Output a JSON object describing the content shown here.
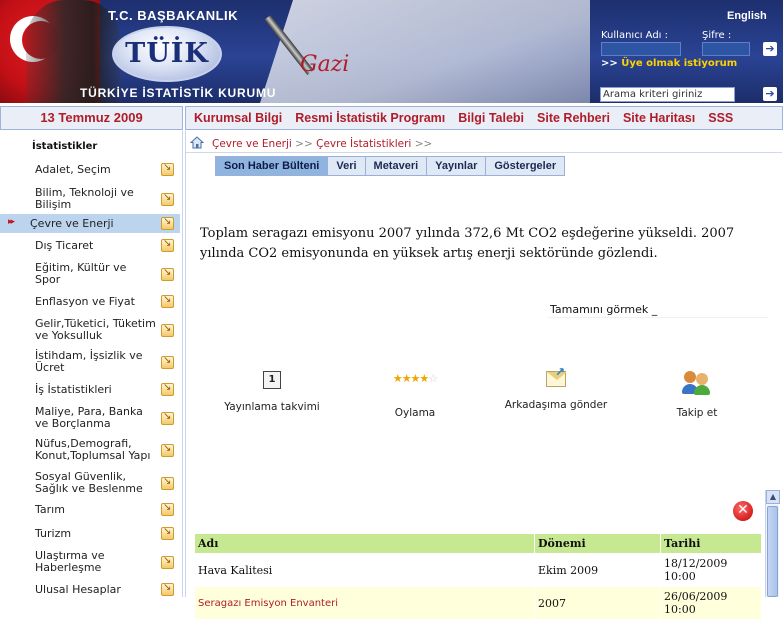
{
  "header": {
    "gov_title": "T.C. BAŞBAKANLIK",
    "logo_text": "TÜİK",
    "org_name": "TÜRKİYE İSTATİSTİK KURUMU",
    "language_link": "English",
    "login": {
      "username_label": "Kullanıcı Adı :",
      "password_label": "Şifre :",
      "go_label": "➔",
      "signup_arrows": ">>",
      "signup_text": "Üye olmak istiyorum"
    },
    "search": {
      "value": "Arama kriteri giriniz",
      "go_label": "➔"
    }
  },
  "date": "13 Temmuz 2009",
  "topnav": [
    {
      "label": "Kurumsal Bilgi"
    },
    {
      "label": "Resmi İstatistik Programı"
    },
    {
      "label": "Bilgi Talebi"
    },
    {
      "label": "Site Rehberi"
    },
    {
      "label": "Site Haritası"
    },
    {
      "label": "SSS"
    }
  ],
  "sidebar": {
    "title": "İstatistikler",
    "active_marker": "▸▸",
    "items": [
      {
        "label": "Adalet, Seçim"
      },
      {
        "label": "Bilim, Teknoloji ve Bilişim"
      },
      {
        "label": "Çevre ve Enerji"
      },
      {
        "label": "Dış Ticaret"
      },
      {
        "label": "Eğitim, Kültür ve Spor"
      },
      {
        "label": "Enflasyon ve Fiyat"
      },
      {
        "label": "Gelir,Tüketici, Tüketim ve Yoksulluk"
      },
      {
        "label": "İstihdam, İşsizlik ve Ücret"
      },
      {
        "label": "İş İstatistikleri"
      },
      {
        "label": "Maliye, Para, Banka ve Borçlanma"
      },
      {
        "label": "Nüfus,Demografi, Konut,Toplumsal Yapı"
      },
      {
        "label": "Sosyal Güvenlik, Sağlık ve Beslenme"
      },
      {
        "label": "Tarım"
      },
      {
        "label": "Turizm"
      },
      {
        "label": "Ulaştırma ve Haberleşme"
      },
      {
        "label": "Ulusal Hesaplar"
      }
    ]
  },
  "breadcrumb": {
    "level1": "Çevre ve Enerji",
    "sep1": ">>",
    "level2": "Çevre İstatistikleri",
    "sep2": ">>"
  },
  "tabs": [
    {
      "label": "Son Haber Bülteni"
    },
    {
      "label": "Veri"
    },
    {
      "label": "Metaveri"
    },
    {
      "label": "Yayınlar"
    },
    {
      "label": "Göstergeler"
    }
  ],
  "summary": "Toplam seragazı emisyonu 2007 yılında 372,6 Mt CO2 eşdeğerine yükseldi. 2007 yılında CO2 emisyonunda en yüksek artış enerji sektöründe gözlendi.",
  "see_all": "Tamamını görmek  _",
  "actions": {
    "calendar": {
      "label": "Yayınlama takvimi",
      "icon_text": "1"
    },
    "rating": {
      "label": "Oylama",
      "filled_stars": "★★★★",
      "empty_stars": "☆",
      "rating": 4,
      "max": 5
    },
    "send": {
      "label": "Arkadaşıma gönder",
      "icon_text": "↗"
    },
    "follow": {
      "label": "Takip et"
    }
  },
  "close_glyph": "✕",
  "results": {
    "columns": [
      "Adı",
      "Dönemi",
      "Tarihi"
    ],
    "rows": [
      {
        "name": "Hava Kalitesi",
        "period": "Ekim 2009",
        "date": "18/12/2009 10:00"
      },
      {
        "name": "Seragazı Emisyon Envanteri",
        "period": "2007",
        "date": "26/06/2009 10:00"
      }
    ]
  },
  "scroll_up_glyph": "▲",
  "colors": {
    "brand_red": "#b01d2a",
    "header_blue": "#2a4394",
    "table_header_green": "#c6e891",
    "active_tab": "#8fb4e0"
  }
}
